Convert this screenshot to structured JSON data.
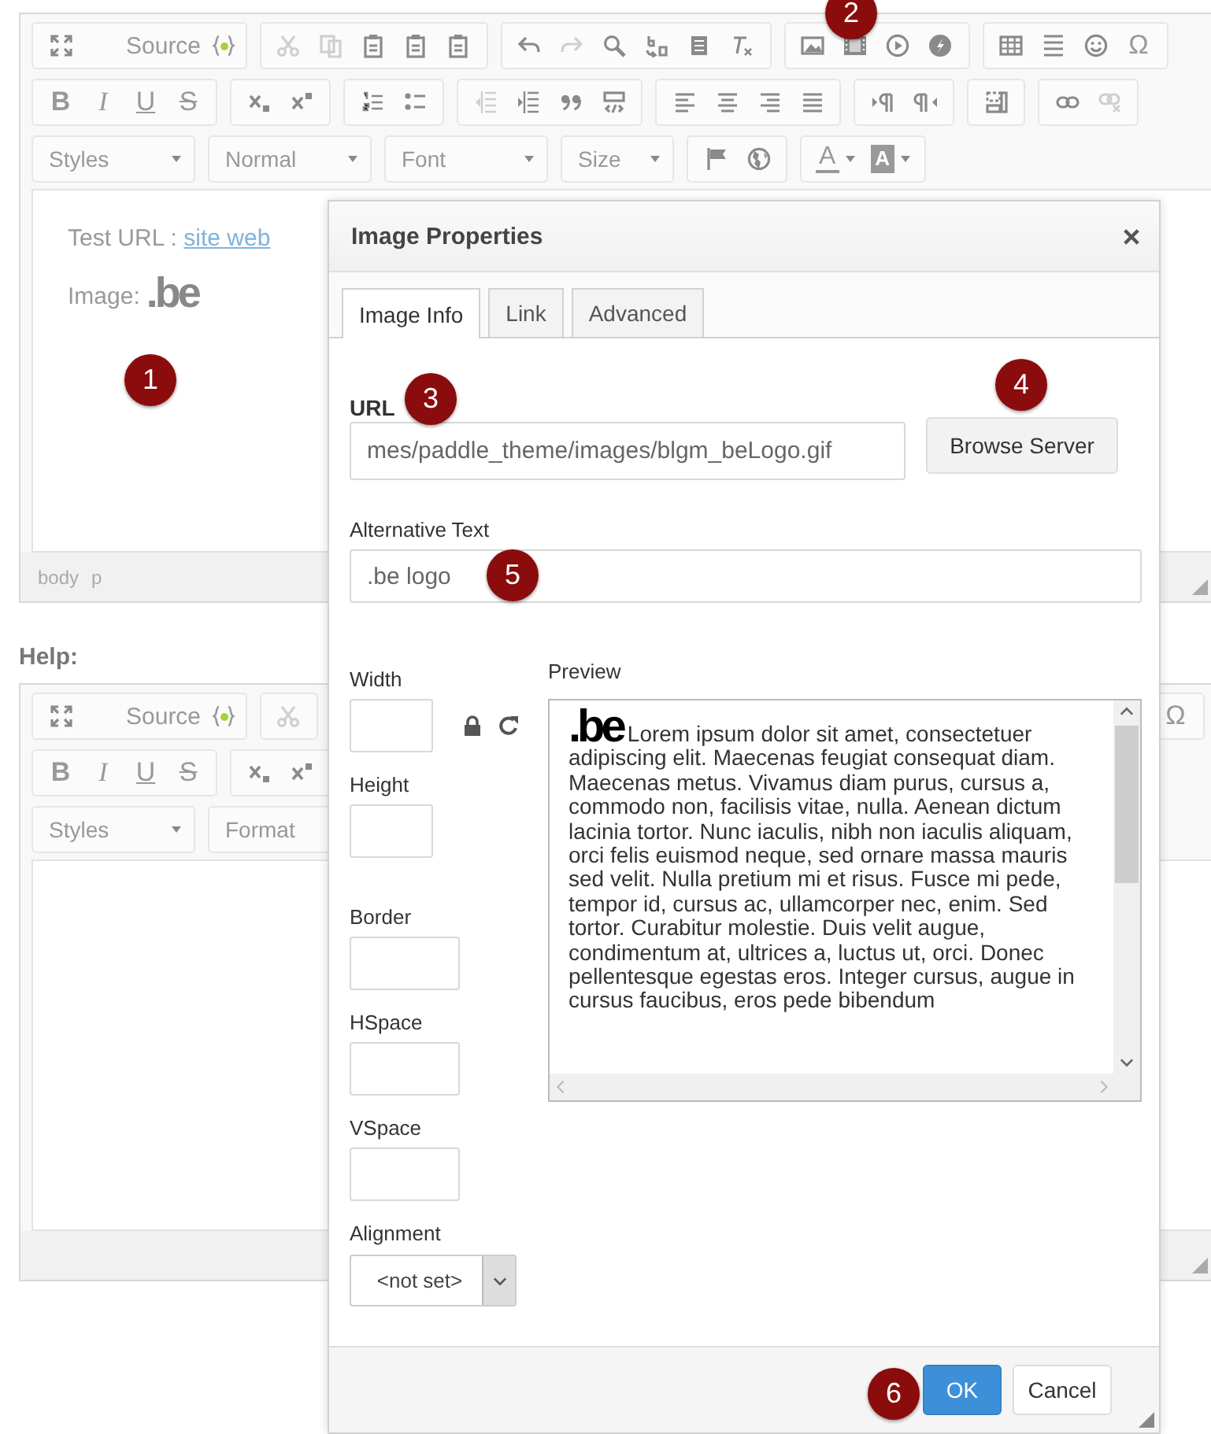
{
  "editors": [
    {
      "toolbar": [
        [
          [
            {
              "kind": "icon",
              "disabled": false
            },
            {
              "kind": "labeled",
              "label": "Source",
              "disabled": false
            }
          ],
          [
            {
              "kind": "icon",
              "disabled": true
            },
            {
              "kind": "icon",
              "disabled": true
            },
            {
              "kind": "icon",
              "disabled": false
            },
            {
              "kind": "icon",
              "disabled": false
            },
            {
              "kind": "icon",
              "disabled": false
            }
          ],
          [
            {
              "kind": "icon",
              "disabled": false
            },
            {
              "kind": "icon",
              "disabled": true
            },
            {
              "kind": "icon",
              "disabled": false
            },
            {
              "kind": "icon",
              "disabled": false
            },
            {
              "kind": "icon",
              "disabled": false
            },
            {
              "kind": "icon",
              "disabled": false
            }
          ],
          [
            {
              "kind": "icon",
              "disabled": false
            },
            {
              "kind": "icon",
              "disabled": false
            },
            {
              "kind": "icon",
              "disabled": false
            },
            {
              "kind": "icon",
              "disabled": false
            }
          ],
          [
            {
              "kind": "icon",
              "disabled": false
            },
            {
              "kind": "icon",
              "disabled": false
            },
            {
              "kind": "icon",
              "disabled": false
            },
            {
              "kind": "glyph",
              "label": "Ω",
              "disabled": false
            }
          ]
        ],
        [
          [
            {
              "kind": "bold",
              "label": "B",
              "disabled": false
            },
            {
              "kind": "italic",
              "label": "I",
              "disabled": false
            },
            {
              "kind": "underline",
              "label": "U",
              "disabled": false
            },
            {
              "kind": "strike",
              "label": "S",
              "disabled": false
            }
          ],
          [
            {
              "kind": "icon",
              "disabled": false
            },
            {
              "kind": "icon",
              "disabled": false
            }
          ],
          [
            {
              "kind": "icon",
              "disabled": false
            },
            {
              "kind": "icon",
              "disabled": false
            }
          ],
          [
            {
              "kind": "icon",
              "disabled": true
            },
            {
              "kind": "icon",
              "disabled": false
            },
            {
              "kind": "icon",
              "disabled": false
            },
            {
              "kind": "icon",
              "disabled": false
            }
          ],
          [
            {
              "kind": "icon",
              "disabled": false
            },
            {
              "kind": "icon",
              "disabled": false
            },
            {
              "kind": "icon",
              "disabled": false
            },
            {
              "kind": "icon",
              "disabled": false
            }
          ],
          [
            {
              "kind": "icon",
              "disabled": false
            },
            {
              "kind": "icon",
              "disabled": false
            }
          ],
          [
            {
              "kind": "icon",
              "disabled": false
            }
          ],
          [
            {
              "kind": "icon",
              "disabled": false
            },
            {
              "kind": "icon",
              "disabled": true
            }
          ]
        ],
        [
          [
            {
              "kind": "combo",
              "label": "Styles",
              "disabled": false
            }
          ],
          [
            {
              "kind": "combo",
              "label": "Normal",
              "disabled": false
            }
          ],
          [
            {
              "kind": "combo",
              "label": "Font",
              "disabled": false
            }
          ],
          [
            {
              "kind": "combo",
              "label": "Size",
              "disabled": false
            }
          ],
          [
            {
              "kind": "icon",
              "disabled": false
            },
            {
              "kind": "icon",
              "disabled": false
            }
          ],
          [
            {
              "kind": "text_color",
              "label": "A",
              "disabled": false
            },
            {
              "kind": "background_color",
              "label": "A",
              "disabled": false
            }
          ]
        ]
      ],
      "content": [
        {
          "kind": "link_line",
          "text": "Test URL : ",
          "link": "site web"
        },
        {
          "kind": "image_line",
          "text": "Image:",
          "logo": ".be"
        }
      ],
      "path": [
        "body",
        "p"
      ]
    },
    {
      "label": "Help:",
      "toolbar": [
        [
          [
            {
              "kind": "icon",
              "disabled": false
            },
            {
              "kind": "labeled",
              "label": "Source",
              "disabled": false
            }
          ],
          [
            {
              "kind": "icon",
              "disabled": true
            }
          ],
          [
            {
              "kind": "glyph",
              "label": "Ω",
              "disabled": false
            }
          ]
        ],
        [
          [
            {
              "kind": "bold",
              "label": "B",
              "disabled": false
            },
            {
              "kind": "italic",
              "label": "I",
              "disabled": false
            },
            {
              "kind": "underline",
              "label": "U",
              "disabled": false
            },
            {
              "kind": "strike",
              "label": "S",
              "disabled": false
            }
          ],
          [
            {
              "kind": "icon",
              "disabled": false
            },
            {
              "kind": "icon",
              "disabled": false
            }
          ]
        ],
        [
          [
            {
              "kind": "combo",
              "label": "Styles",
              "disabled": false
            }
          ],
          [
            {
              "kind": "combo",
              "label": "Format",
              "disabled": false
            }
          ]
        ]
      ]
    }
  ],
  "dialog": {
    "title": "Image Properties",
    "tabs": [
      {
        "label": "Image Info",
        "selected": true
      },
      {
        "label": "Link",
        "selected": false
      },
      {
        "label": "Advanced",
        "selected": false
      }
    ],
    "url": {
      "label": "URL",
      "value": "mes/paddle_theme/images/blgm_beLogo.gif"
    },
    "browse_button": "Browse Server",
    "alt": {
      "label": "Alternative Text",
      "value": ".be logo"
    },
    "fields": [
      {
        "label": "Width"
      },
      {
        "label": "Height"
      },
      {
        "label": "Border"
      },
      {
        "label": "HSpace"
      },
      {
        "label": "VSpace"
      }
    ],
    "alignment": {
      "label": "Alignment",
      "value": "<not set>"
    },
    "preview": {
      "label": "Preview",
      "logo": ".be",
      "text": "Lorem ipsum dolor sit amet, consectetuer adipiscing elit. Maecenas feugiat consequat diam. Maecenas metus. Vivamus diam purus, cursus a, commodo non, facilisis vitae, nulla. Aenean dictum lacinia tortor. Nunc iaculis, nibh non iaculis aliquam, orci felis euismod neque, sed ornare massa mauris sed velit. Nulla pretium mi et risus. Fusce mi pede, tempor id, cursus ac, ullamcorper nec, enim. Sed tortor. Curabitur molestie. Duis velit augue, condimentum at, ultrices a, luctus ut, orci. Donec pellentesque egestas eros. Integer cursus, augue in cursus faucibus, eros pede bibendum"
    },
    "buttons": [
      {
        "label": "OK",
        "kind": "primary"
      },
      {
        "label": "Cancel",
        "kind": "secondary"
      }
    ]
  },
  "badges": [
    "1",
    "2",
    "3",
    "4",
    "5",
    "6"
  ]
}
